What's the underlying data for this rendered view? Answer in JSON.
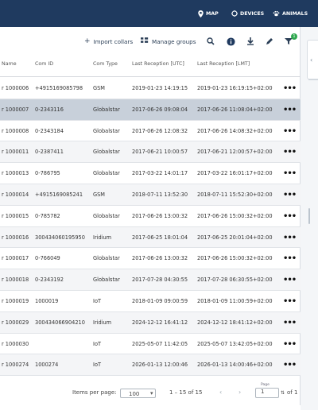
{
  "top_nav": {
    "map": "MAP",
    "devices": "DEVICES",
    "animals": "ANIMALS"
  },
  "toolbar": {
    "import_collars": "Import collars",
    "manage_groups": "Manage groups",
    "filter_badge": "1"
  },
  "table": {
    "headers": [
      "Name",
      "Com ID",
      "Com Type",
      "Last Reception [UTC]",
      "Last Reception [LMT]"
    ],
    "rows": [
      [
        "r 1000006",
        "+4915169085798",
        "GSM",
        "2019-01-23 14:19:15",
        "2019-01-23 16:19:15+02:00"
      ],
      [
        "r 1000007",
        "0-2343116",
        "Globalstar",
        "2017-06-26 09:08:04",
        "2017-06-26 11:08:04+02:00"
      ],
      [
        "r 1000008",
        "0-2343184",
        "Globalstar",
        "2017-06-26 12:08:32",
        "2017-06-26 14:08:32+02:00"
      ],
      [
        "r 1000011",
        "0-2387411",
        "Globalstar",
        "2017-06-21 10:00:57",
        "2017-06-21 12:00:57+02:00"
      ],
      [
        "r 1000013",
        "0-786795",
        "Globalstar",
        "2017-03-22 14:01:17",
        "2017-03-22 16:01:17+02:00"
      ],
      [
        "r 1000014",
        "+4915169085241",
        "GSM",
        "2018-07-11 13:52:30",
        "2018-07-11 15:52:30+02:00"
      ],
      [
        "r 1000015",
        "0-785782",
        "Globalstar",
        "2017-06-26 13:00:32",
        "2017-06-26 15:00:32+02:00"
      ],
      [
        "r 1000016",
        "300434060195950",
        "Iridium",
        "2017-06-25 18:01:04",
        "2017-06-25 20:01:04+02:00"
      ],
      [
        "r 1000017",
        "0-766049",
        "Globalstar",
        "2017-06-26 13:00:32",
        "2017-06-26 15:00:32+02:00"
      ],
      [
        "r 1000018",
        "0-2343192",
        "Globalstar",
        "2017-07-28 04:30:55",
        "2017-07-28 06:30:55+02:00"
      ],
      [
        "r 1000019",
        "1000019",
        "IoT",
        "2018-01-09 09:00:59",
        "2018-01-09 11:00:59+02:00"
      ],
      [
        "r 1000029",
        "300434066904210",
        "Iridium",
        "2024-12-12 16:41:12",
        "2024-12-12 18:41:12+02:00"
      ],
      [
        "r 1000030",
        "",
        "IoT",
        "2025-05-07 11:42:05",
        "2025-05-07 13:42:05+02:00"
      ],
      [
        "r 1000274",
        "1000274",
        "IoT",
        "2026-01-13 12:00:46",
        "2026-01-13 14:00:46+02:00"
      ]
    ]
  },
  "footer": {
    "items_per_page_label": "Items per page:",
    "items_per_page_value": "100",
    "range": "1 – 15 of 15",
    "page_label": "Page",
    "page_value": "1",
    "of_total": "of 1"
  },
  "colors": {
    "topbar": "#1f3a5f",
    "selected_row": "#c8d0da",
    "alt_row": "#f4f5f7",
    "toolbar_text": "#2b3f57",
    "badge": "#2fa84f"
  },
  "icons": {
    "map": "location-pin-icon",
    "devices": "device-ring-icon",
    "animals": "paw-icon",
    "import": "plus-icon",
    "groups": "groups-icon",
    "search": "search-icon",
    "info": "info-icon",
    "download": "download-icon",
    "edit": "edit-pencil-icon",
    "filter": "filter-icon",
    "row_actions": "more-horizontal-icon",
    "pager_prev": "chevron-left-icon",
    "pager_next": "chevron-right-icon"
  }
}
